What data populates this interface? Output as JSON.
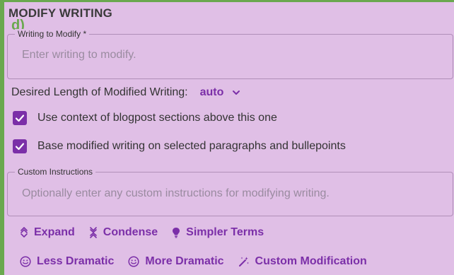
{
  "section": {
    "title": "MODIFY WRITING",
    "step": "d)"
  },
  "writing_field": {
    "label": "Writing to Modify *",
    "placeholder": "Enter writing to modify."
  },
  "length": {
    "label": "Desired Length of Modified Writing:",
    "value": "auto"
  },
  "checkboxes": [
    {
      "label": "Use context of blogpost sections above this one",
      "checked": true
    },
    {
      "label": "Base modified writing on selected paragraphs and bullepoints",
      "checked": true
    }
  ],
  "custom_field": {
    "label": "Custom Instructions",
    "placeholder": "Optionally enter any custom instructions for modifying writing."
  },
  "actions_row1": [
    {
      "label": "Expand",
      "icon": "expand-icon"
    },
    {
      "label": "Condense",
      "icon": "condense-icon"
    },
    {
      "label": "Simpler Terms",
      "icon": "lightbulb-icon"
    }
  ],
  "actions_row2": [
    {
      "label": "Less Dramatic",
      "icon": "smiley-icon"
    },
    {
      "label": "More Dramatic",
      "icon": "smiley-icon"
    },
    {
      "label": "Custom Modification",
      "icon": "magic-wand-icon"
    }
  ],
  "colors": {
    "panel_background": "#e0bfe6",
    "accent": "#7b2fa8",
    "step_border": "#6aa84f"
  }
}
